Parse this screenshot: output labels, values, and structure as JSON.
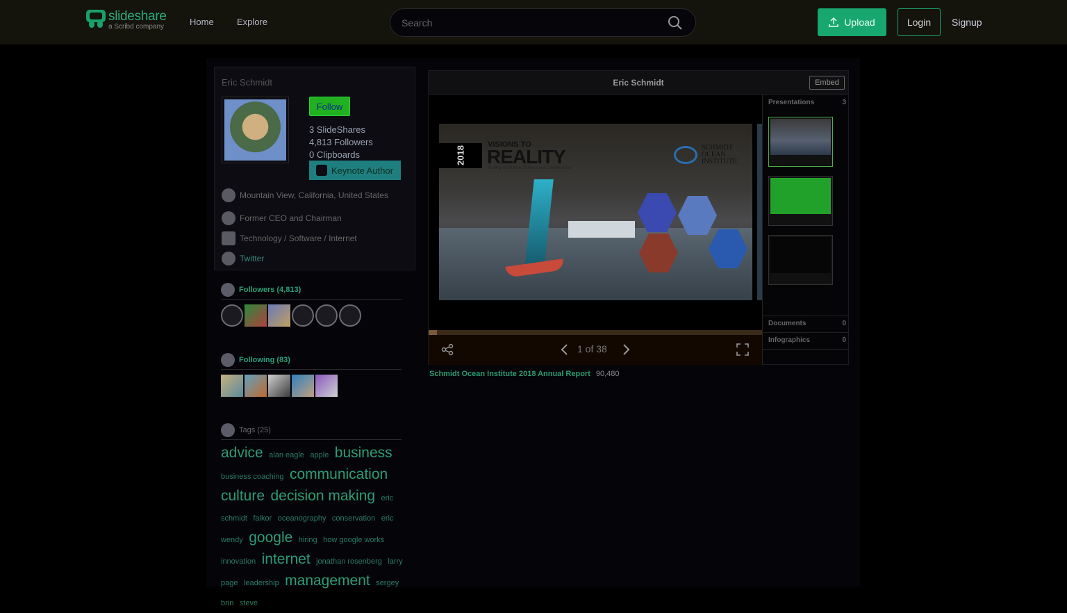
{
  "brand": {
    "name": "slideshare",
    "sub": "a Scribd company"
  },
  "nav": {
    "home": "Home",
    "explore": "Explore"
  },
  "search": {
    "placeholder": "Search"
  },
  "header": {
    "upload": "Upload",
    "login": "Login",
    "signup": "Signup"
  },
  "profile": {
    "name": "Eric Schmidt",
    "follow": "Follow",
    "slideshares": "3 SlideShares",
    "followers": "4,813 Followers",
    "clipboards": "0 Clipboards",
    "badge": "Keynote Author",
    "location": "Mountain View, California, United States",
    "role": "Former CEO and Chairman",
    "industry": "Technology / Software / Internet",
    "twitter": "Twitter"
  },
  "followers_section": {
    "title": "Followers (4,813)"
  },
  "following_section": {
    "title": "Following (83)"
  },
  "tags_section": {
    "title": "Tags (25)"
  },
  "tags": [
    {
      "text": "advice",
      "size": "lg"
    },
    {
      "text": "alan eagle",
      "size": "sm"
    },
    {
      "text": "apple",
      "size": "sm"
    },
    {
      "text": "business",
      "size": "lg"
    },
    {
      "text": "business coaching",
      "size": "sm"
    },
    {
      "text": "communication",
      "size": "lg"
    },
    {
      "text": "culture",
      "size": "lg"
    },
    {
      "text": "decision making",
      "size": "lg"
    },
    {
      "text": "eric schmidt",
      "size": "sm"
    },
    {
      "text": "falkor",
      "size": "sm"
    },
    {
      "text": "oceanography",
      "size": "sm"
    },
    {
      "text": "conservation",
      "size": "sm"
    },
    {
      "text": "eric",
      "size": "sm"
    },
    {
      "text": "wendy",
      "size": "sm"
    },
    {
      "text": "google",
      "size": "lg"
    },
    {
      "text": "hiring",
      "size": "sm"
    },
    {
      "text": "how google works",
      "size": "sm"
    },
    {
      "text": "innovation",
      "size": "sm"
    },
    {
      "text": "internet",
      "size": "lg"
    },
    {
      "text": "jonathan rosenberg",
      "size": "sm"
    },
    {
      "text": "larry page",
      "size": "sm"
    },
    {
      "text": "leadership",
      "size": "sm"
    },
    {
      "text": "management",
      "size": "lg"
    },
    {
      "text": "sergey brin",
      "size": "sm"
    },
    {
      "text": "steve",
      "size": "sm"
    }
  ],
  "viewer": {
    "title": "Eric Schmidt",
    "embed": "Embed",
    "page_indicator": "1 of 38",
    "progress": 0.026
  },
  "slide": {
    "year": "2018",
    "line1": "VISIONS TO",
    "line2": "REALITY",
    "subtitle": "Scaling Up Marine Science and Conservation",
    "org": "SCHMIDT OCEAN INSTITUTE"
  },
  "sidebar": {
    "presentations_label": "Presentations",
    "presentations_count": "3",
    "documents_label": "Documents",
    "documents_count": "0",
    "infographics_label": "Infographics",
    "infographics_count": "0"
  },
  "presentation": {
    "title": "Schmidt Ocean Institute 2018 Annual Report",
    "views": "90,480"
  }
}
